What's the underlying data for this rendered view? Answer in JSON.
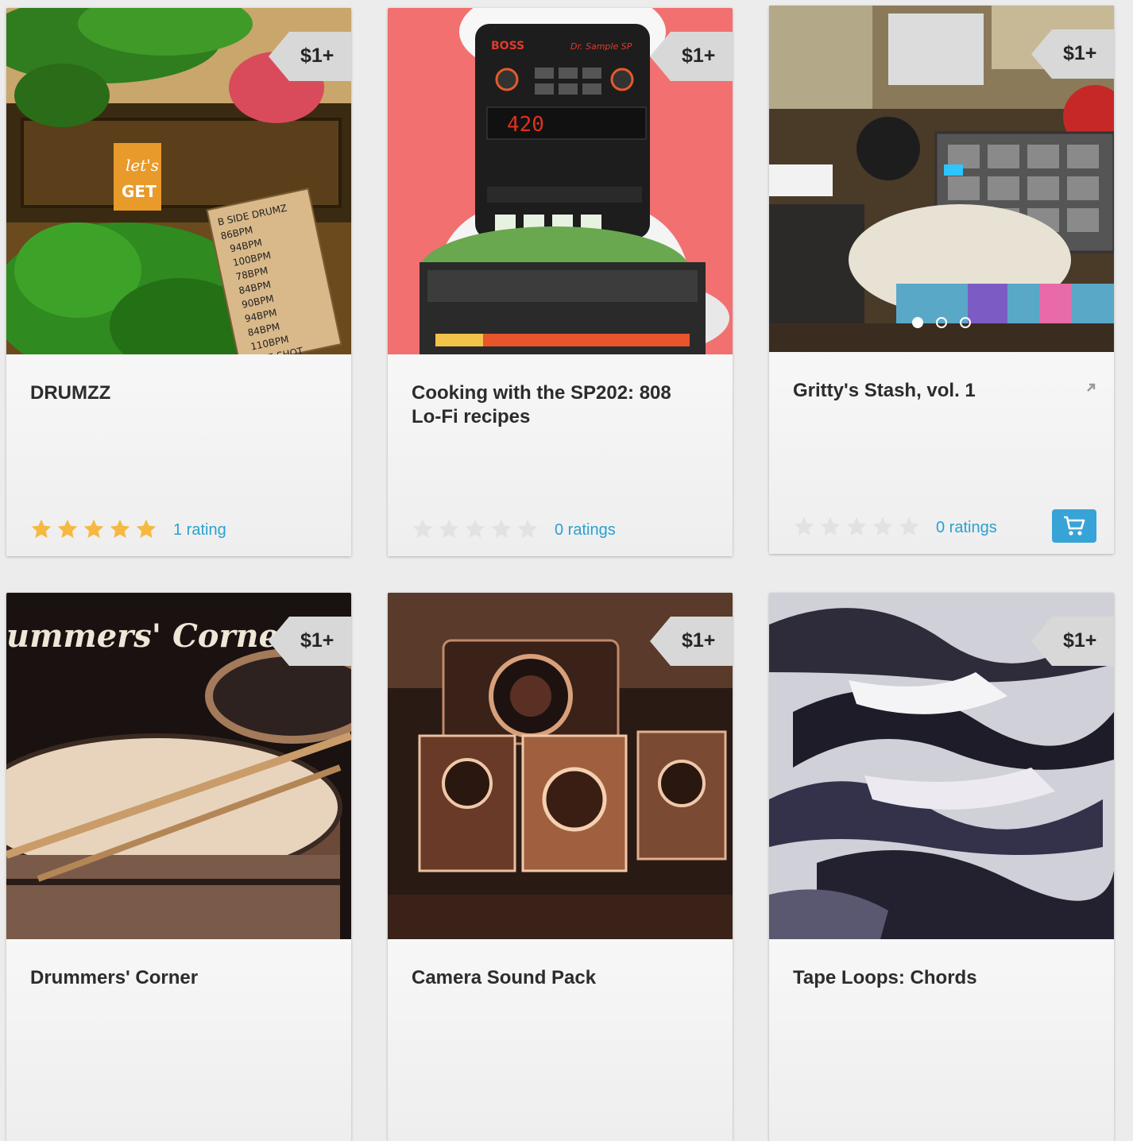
{
  "products": [
    {
      "title": "DRUMZZ",
      "price": "$1+",
      "stars": 5,
      "rating_text": "1 rating"
    },
    {
      "title": "Cooking with the SP202: 808 Lo-Fi recipes",
      "price": "$1+",
      "stars": 0,
      "rating_text": "0 ratings"
    },
    {
      "title": "Gritty's Stash, vol. 1",
      "price": "$1+",
      "stars": 0,
      "rating_text": "0 ratings",
      "carousel_slides": 3,
      "carousel_active": 1
    },
    {
      "title": "Drummers' Corner",
      "price": "$1+"
    },
    {
      "title": "Camera Sound Pack",
      "price": "$1+"
    },
    {
      "title": "Tape Loops: Chords",
      "price": "$1+"
    }
  ],
  "thumb_text": {
    "drumzz_sign_1": "let's",
    "drumzz_sign_2": "GET",
    "drumzz_note": [
      "B SIDE DRUMZ",
      "86BPM",
      "94BPM",
      "100BPM",
      "78BPM",
      "84BPM",
      "90BPM",
      "94BPM",
      "84BPM",
      "110BPM",
      "ONE SHOT"
    ],
    "sp202_brand": "BOSS",
    "sp202_model": "Dr. Sample SP",
    "sp202_display": "420",
    "drummers_script": "ummers' Corner"
  },
  "colors": {
    "star_filled": "#f5b942",
    "star_empty": "#e2e2e2",
    "link": "#2aa1cf",
    "cart": "#38a3d6",
    "price_tag": "#d8d8d8"
  },
  "icons": {
    "cart": "shopping-cart-icon",
    "external": "external-link-icon",
    "star": "star-icon"
  }
}
